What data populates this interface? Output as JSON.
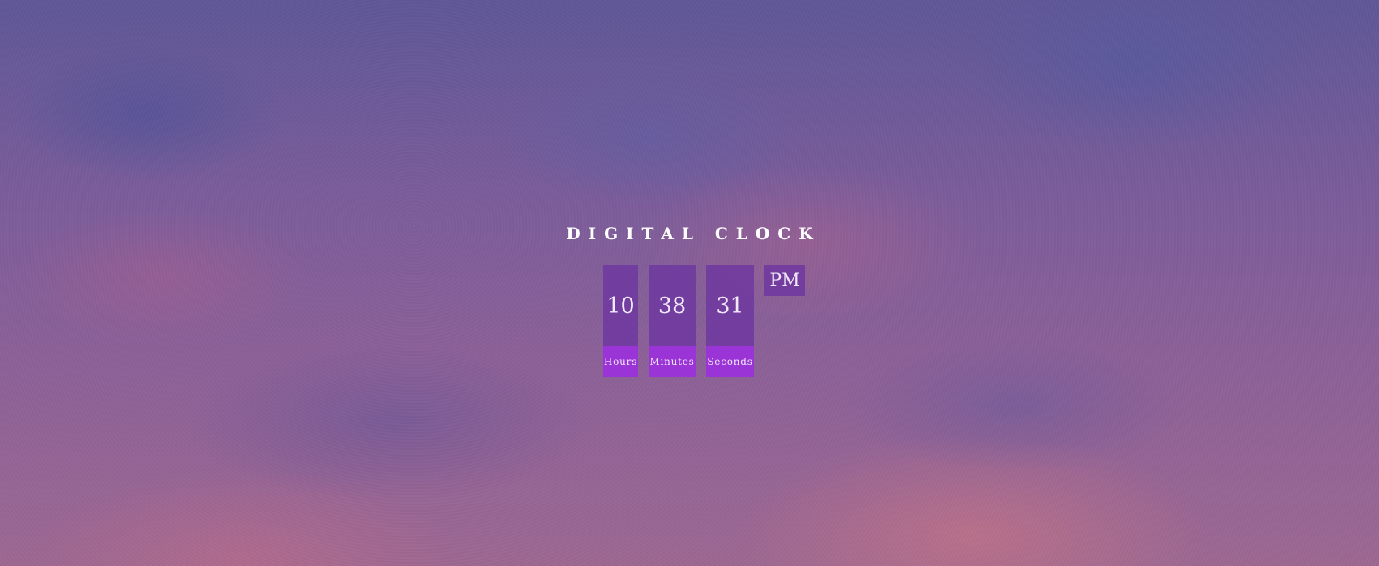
{
  "page": {
    "title": "DIGITAL CLOCK"
  },
  "clock": {
    "hours": {
      "value": "10",
      "label": "Hours"
    },
    "minutes": {
      "value": "38",
      "label": "Minutes"
    },
    "seconds": {
      "value": "31",
      "label": "Seconds"
    },
    "period": "PM"
  },
  "colors": {
    "digit_panel": "#6e37a0",
    "label_panel": "#9a34d6",
    "text": "#f1e8fb"
  }
}
